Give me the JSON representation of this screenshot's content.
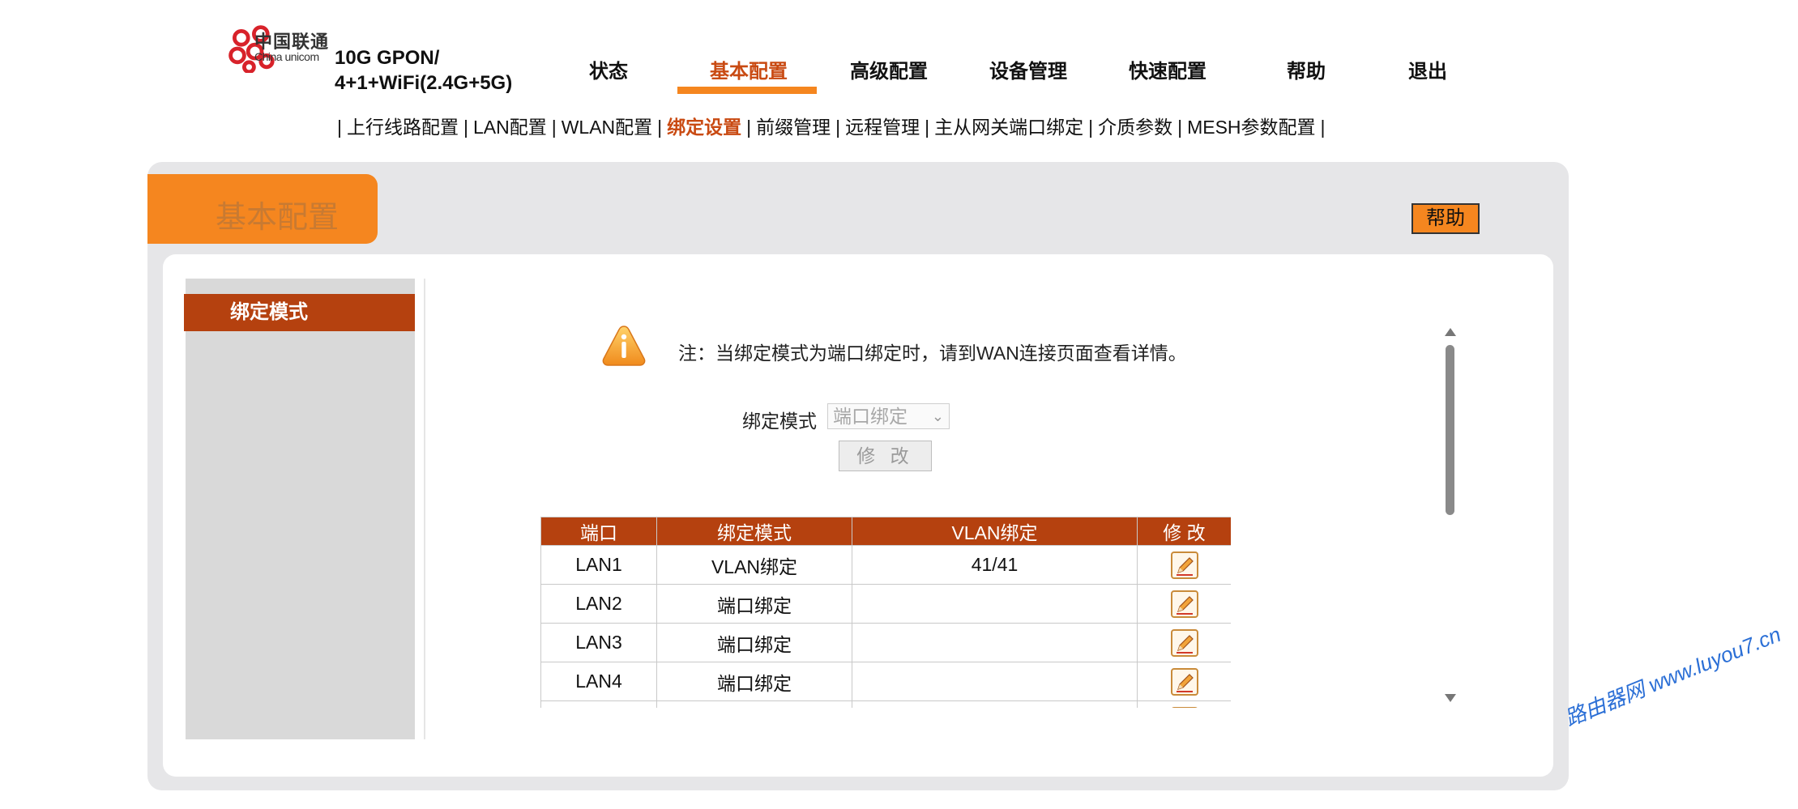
{
  "header": {
    "logo_cn": "中国联通",
    "logo_en": "China unicom",
    "model_line1": "10G GPON/",
    "model_line2": "4+1+WiFi(2.4G+5G)"
  },
  "nav": [
    {
      "label": "状态"
    },
    {
      "label": "基本配置"
    },
    {
      "label": "高级配置"
    },
    {
      "label": "设备管理"
    },
    {
      "label": "快速配置"
    },
    {
      "label": "帮助"
    },
    {
      "label": "退出"
    }
  ],
  "subnav": [
    {
      "label": "上行线路配置"
    },
    {
      "label": "LAN配置"
    },
    {
      "label": "WLAN配置"
    },
    {
      "label": "绑定设置"
    },
    {
      "label": "前缀管理"
    },
    {
      "label": "远程管理"
    },
    {
      "label": "主从网关端口绑定"
    },
    {
      "label": "介质参数"
    },
    {
      "label": "MESH参数配置"
    }
  ],
  "subnav_separator": "|",
  "page": {
    "title": "基本配置",
    "help_label": "帮助"
  },
  "sidebar": {
    "items": [
      {
        "label": "绑定模式"
      }
    ]
  },
  "content": {
    "note": "注：当绑定模式为端口绑定时，请到WAN连接页面查看详情。",
    "mode_label": "绑定模式",
    "mode_value": "端口绑定",
    "modify_button": "修 改"
  },
  "table": {
    "headers": [
      "端口",
      "绑定模式",
      "VLAN绑定",
      "修 改"
    ],
    "rows": [
      {
        "port": "LAN1",
        "mode": "VLAN绑定",
        "vlan": "41/41"
      },
      {
        "port": "LAN2",
        "mode": "端口绑定",
        "vlan": ""
      },
      {
        "port": "LAN3",
        "mode": "端口绑定",
        "vlan": ""
      },
      {
        "port": "LAN4",
        "mode": "端口绑定",
        "vlan": ""
      },
      {
        "port": "",
        "mode": "",
        "vlan": ""
      }
    ]
  },
  "watermark": "路由器网 www.luyou7.cn",
  "colors": {
    "accent_orange": "#f5861f",
    "active_red": "#c94a12",
    "header_brown": "#b5410f",
    "panel_gray": "#e6e6e8",
    "logo_red": "#d8222a",
    "watermark_blue": "#2b6fd6"
  },
  "icons": {
    "logo": "china-unicom-knot-icon",
    "warning": "warning-triangle-icon",
    "edit": "pencil-edit-icon"
  }
}
